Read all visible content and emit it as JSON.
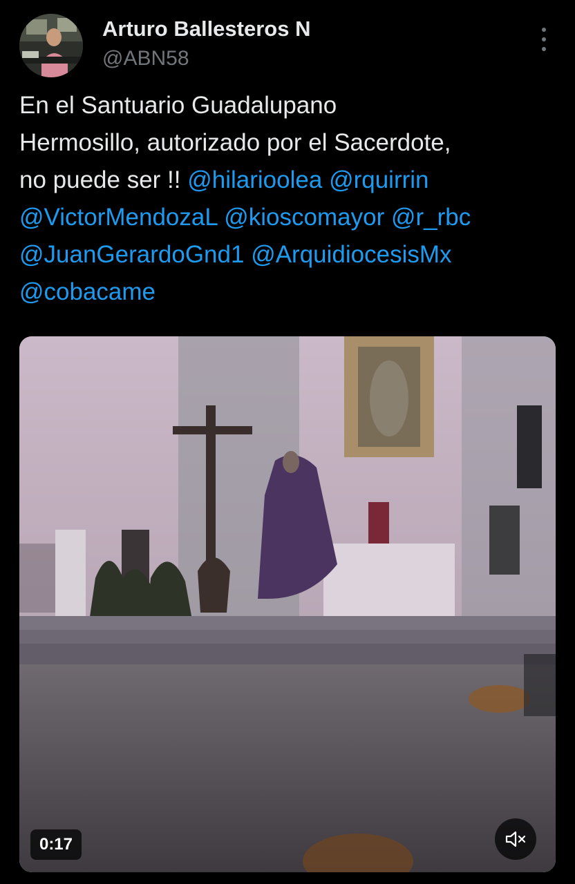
{
  "author": {
    "name": "Arturo Ballesteros N",
    "handle": "@ABN58",
    "avatar_icon": "profile-photo"
  },
  "tweet": {
    "lines": [
      [
        {
          "text": "En el Santuario Guadalupano",
          "type": "text"
        }
      ],
      [
        {
          "text": "Hermosillo, autorizado por el Sacerdote,",
          "type": "text"
        }
      ],
      [
        {
          "text": "no puede ser !! ",
          "type": "text"
        },
        {
          "text": "@hilarioolea",
          "type": "mention"
        },
        {
          "text": " ",
          "type": "text"
        },
        {
          "text": "@rquirrin",
          "type": "mention"
        }
      ],
      [
        {
          "text": "@VictorMendozaL",
          "type": "mention"
        },
        {
          "text": " ",
          "type": "text"
        },
        {
          "text": "@kioscomayor",
          "type": "mention"
        },
        {
          "text": " ",
          "type": "text"
        },
        {
          "text": "@r_rbc",
          "type": "mention"
        }
      ],
      [
        {
          "text": "@JuanGerardoGnd1",
          "type": "mention"
        },
        {
          "text": " ",
          "type": "text"
        },
        {
          "text": "@ArquidiocesisMx",
          "type": "mention"
        }
      ],
      [
        {
          "text": "@cobacame",
          "type": "mention"
        }
      ]
    ]
  },
  "video": {
    "duration": "0:17",
    "mute_icon": "speaker-muted-icon"
  },
  "colors": {
    "background": "#000000",
    "text": "#e7e9ea",
    "secondary": "#71767b",
    "mention": "#1d9bf0"
  }
}
